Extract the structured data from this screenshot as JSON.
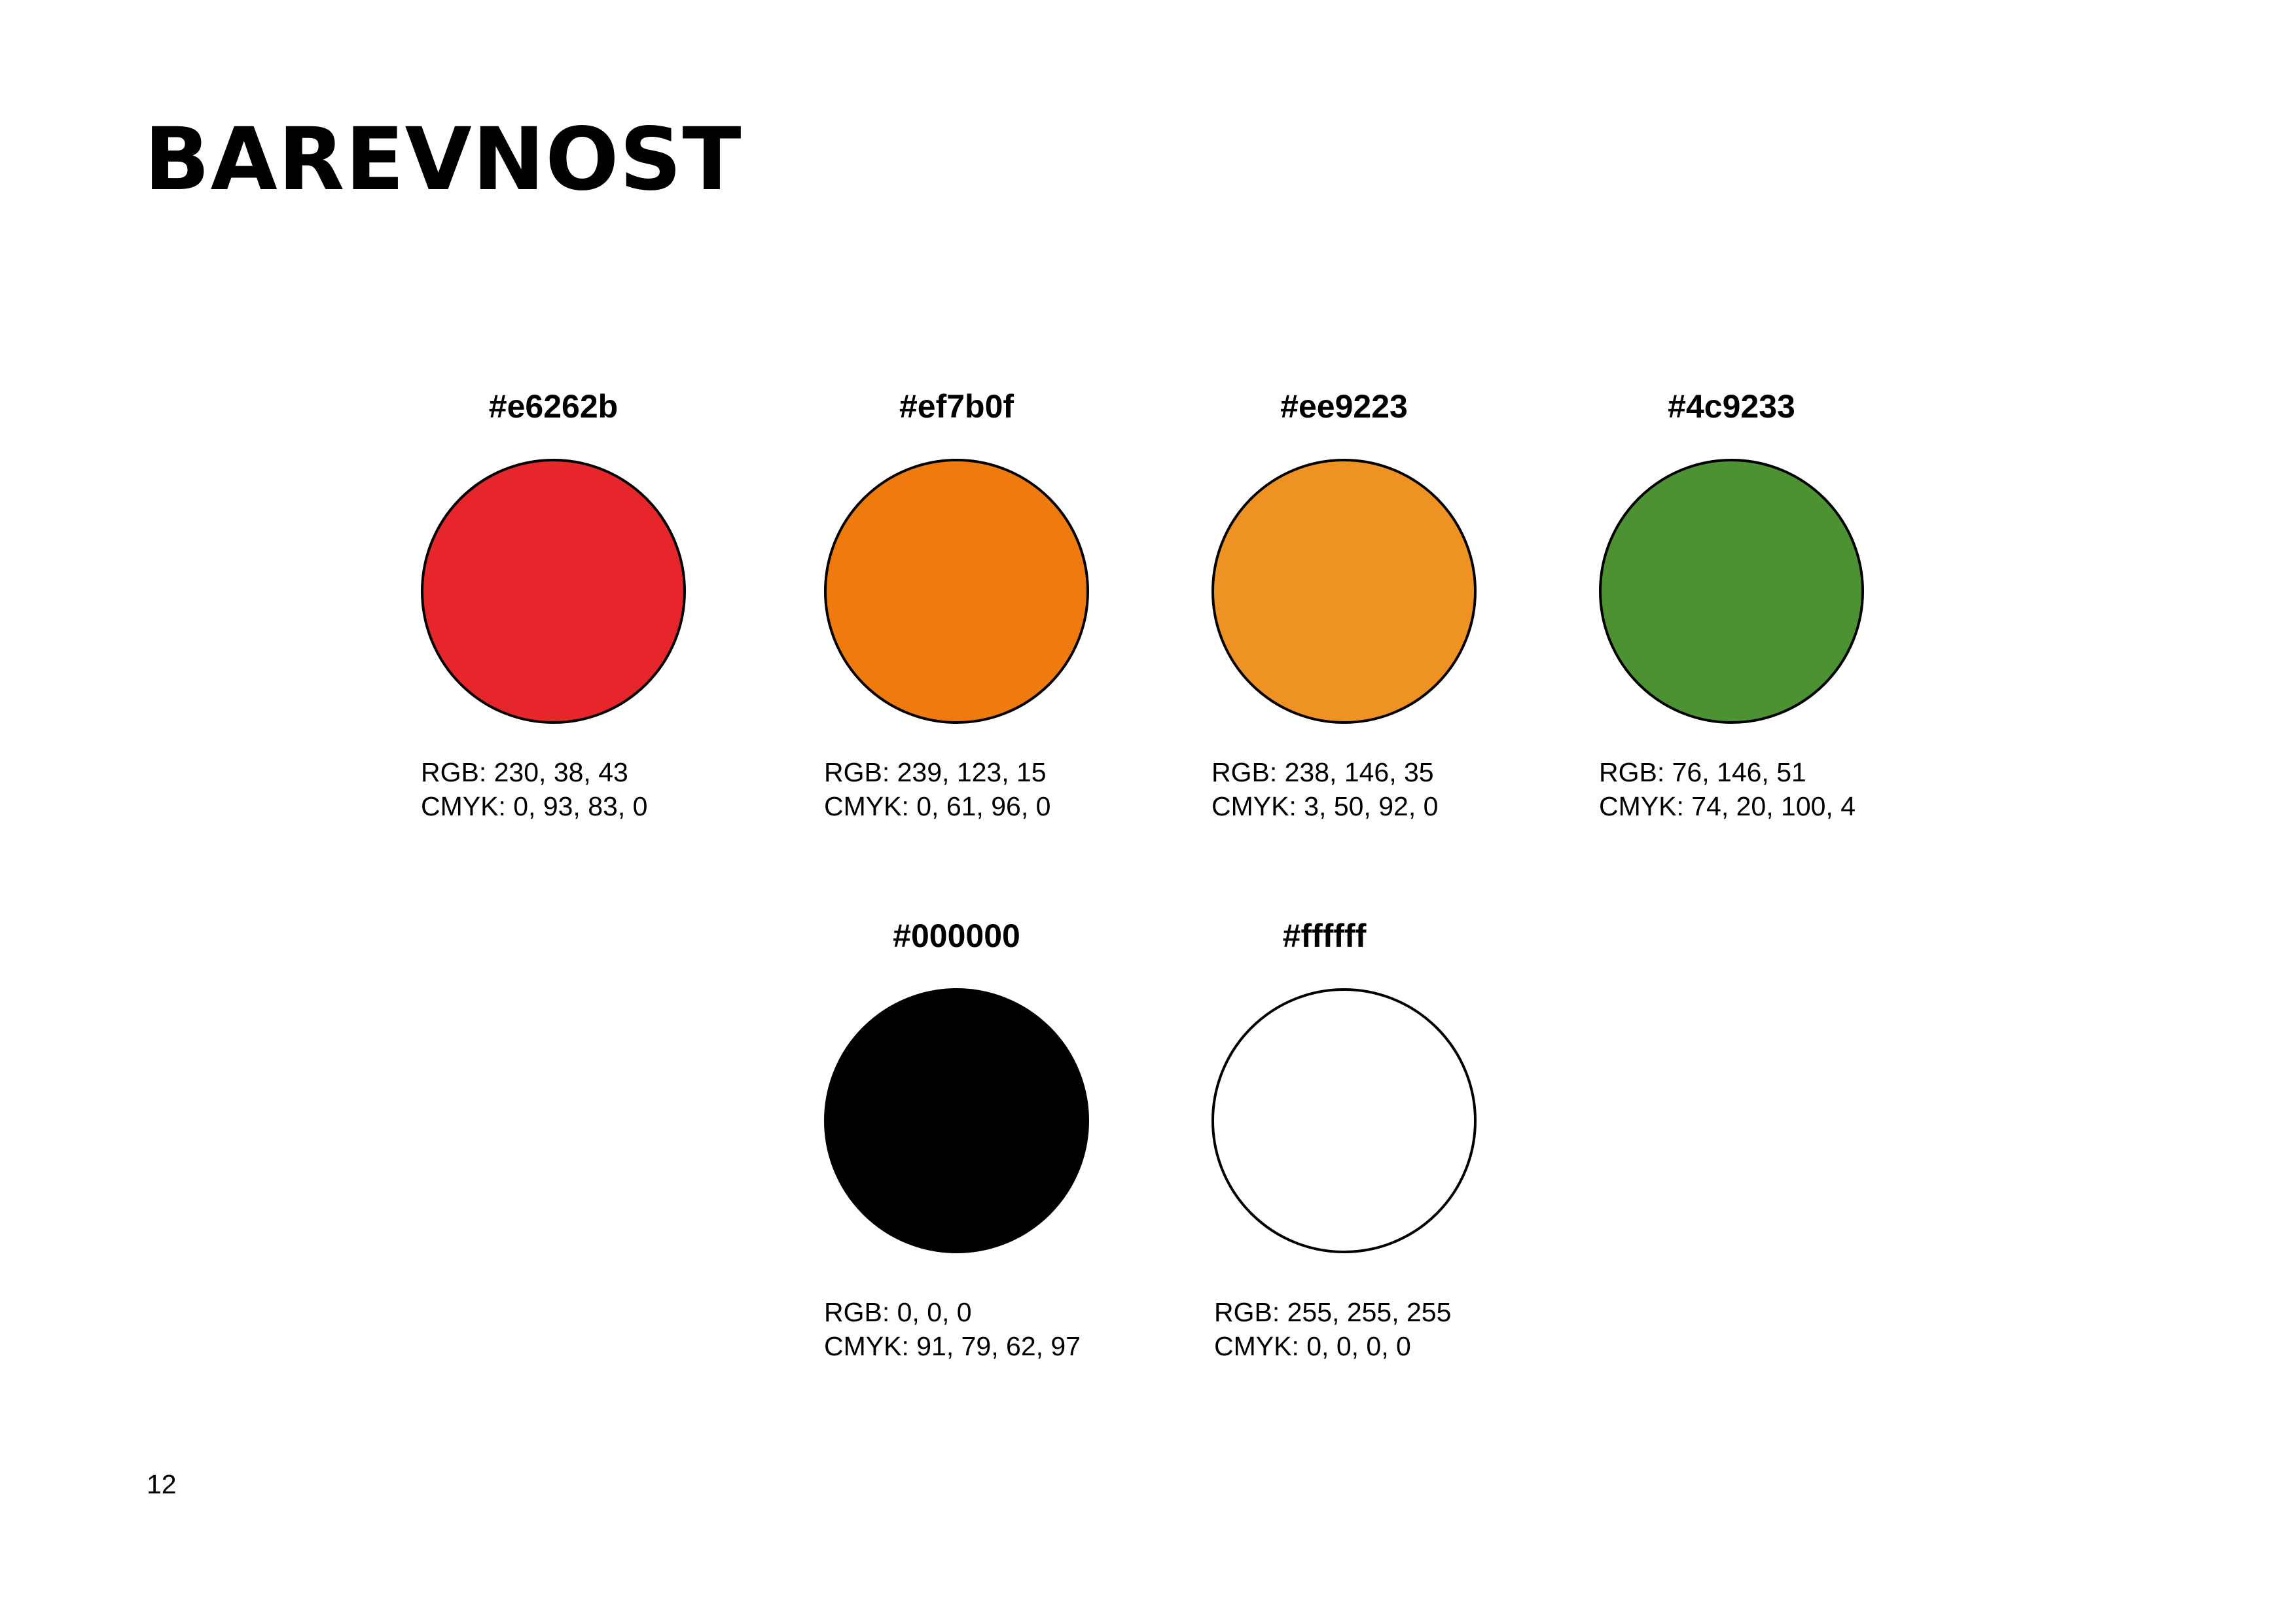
{
  "title": "BAREVNOST",
  "swatches": [
    {
      "hex_label": "#e6262b",
      "color": "#e6262b",
      "rgb": "RGB: 230, 38, 43",
      "cmyk": "CMYK: 0, 93, 83, 0"
    },
    {
      "hex_label": "#ef7b0f",
      "color": "#ef7b0f",
      "rgb": "RGB: 239, 123, 15",
      "cmyk": "CMYK: 0, 61, 96, 0"
    },
    {
      "hex_label": "#ee9223",
      "color": "#ee9223",
      "rgb": "RGB: 238, 146, 35",
      "cmyk": "CMYK: 3, 50, 92, 0"
    },
    {
      "hex_label": "#4c9233",
      "color": "#4c9233",
      "rgb": "RGB: 76, 146, 51",
      "cmyk": "CMYK: 74, 20, 100, 4"
    },
    {
      "hex_label": "#000000",
      "color": "#000000",
      "rgb": "RGB: 0, 0, 0",
      "cmyk": "CMYK: 91, 79, 62, 97"
    },
    {
      "hex_label": "#ffffff",
      "color": "#ffffff",
      "rgb": "RGB: 255, 255, 255",
      "cmyk": "CMYK: 0, 0, 0, 0"
    }
  ],
  "page_number": "12"
}
